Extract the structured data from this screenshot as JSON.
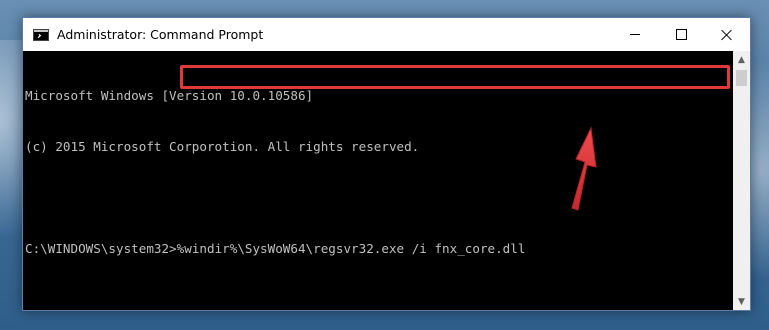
{
  "window": {
    "title": "Administrator: Command Prompt",
    "icon": "cmd-icon"
  },
  "controls": {
    "minimize": "minimize-icon",
    "maximize": "maximize-icon",
    "close": "close-icon"
  },
  "console": {
    "lines": [
      "Microsoft Windows [Version 10.0.10586]",
      "(c) 2015 Microsoft Corporotion. All rights reserved.",
      ""
    ],
    "prompt": "C:\\WINDOWS\\system32>",
    "command": "%windir%\\SysWoW64\\regsvr32.exe /i fnx_core.dll"
  },
  "annotation": {
    "highlight_color": "#e0383b",
    "arrow_color": "#e0383b"
  }
}
